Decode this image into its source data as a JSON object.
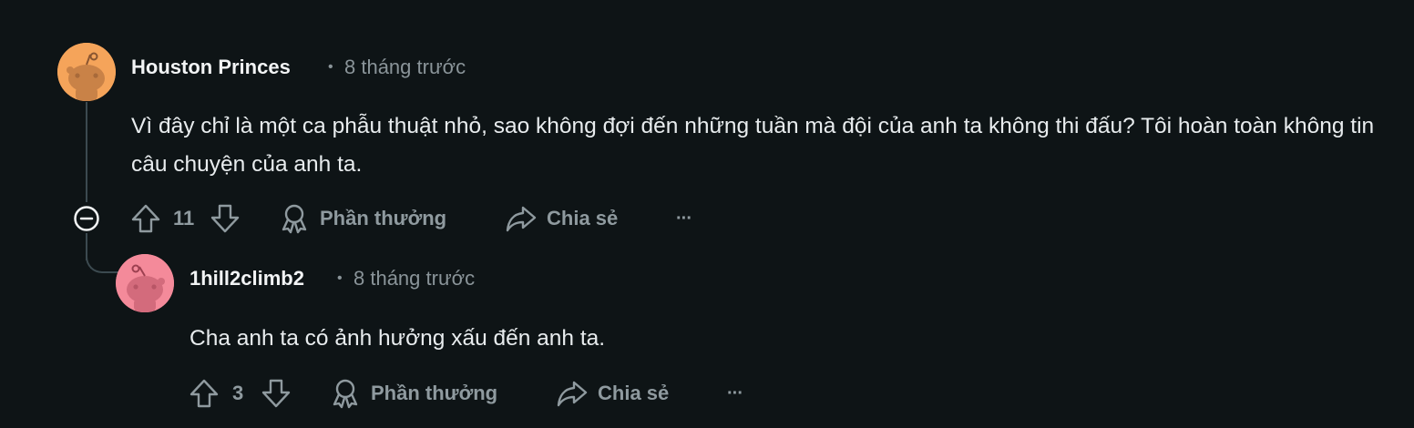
{
  "comments": [
    {
      "author": "Houston Princes",
      "separator": "•",
      "timestamp": "8 tháng trước",
      "body": "Vì đây chỉ là một ca phẫu thuật nhỏ, sao không đợi đến những tuần mà đội của anh ta không thi đấu? Tôi hoàn toàn không tin câu chuyện của anh ta.",
      "score": "11",
      "award_label": "Phần thưởng",
      "share_label": "Chia sẻ",
      "more_label": "···",
      "avatar_color": "#f5a45a"
    },
    {
      "author": "1hill2climb2",
      "separator": "•",
      "timestamp": "8 tháng trước",
      "body": "Cha anh ta có ảnh hưởng xấu đến anh ta.",
      "score": "3",
      "award_label": "Phần thưởng",
      "share_label": "Chia sẻ",
      "more_label": "···",
      "avatar_color": "#f48a9a"
    }
  ],
  "icons": {
    "upvote": "arrow-up-icon",
    "downvote": "arrow-down-icon",
    "award": "award-icon",
    "share": "share-icon",
    "collapse": "collapse-thread-icon",
    "more": "more-options-icon"
  }
}
